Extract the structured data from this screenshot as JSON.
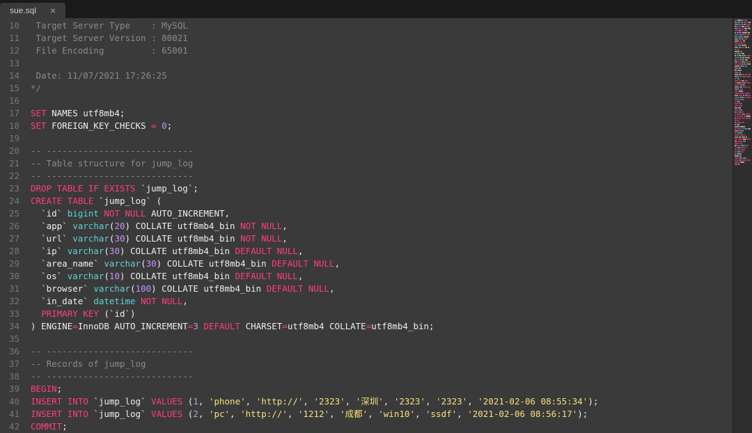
{
  "tab": {
    "label": "sue.sql",
    "close": "×"
  },
  "gutter": [
    "10",
    "11",
    "12",
    "13",
    "14",
    "15",
    "16",
    "17",
    "18",
    "19",
    "20",
    "21",
    "22",
    "23",
    "24",
    "25",
    "26",
    "27",
    "28",
    "29",
    "30",
    "31",
    "32",
    "33",
    "34",
    "35",
    "36",
    "37",
    "38",
    "39",
    "40",
    "41",
    "42"
  ],
  "lines": [
    [
      {
        "t": " Target Server Type    : MySQL",
        "c": "c-cmt"
      }
    ],
    [
      {
        "t": " Target Server Version : 80021",
        "c": "c-cmt"
      }
    ],
    [
      {
        "t": " File Encoding         : 65001",
        "c": "c-cmt"
      }
    ],
    [],
    [
      {
        "t": " Date: 11/07/2021 17:26:25",
        "c": "c-cmt"
      }
    ],
    [
      {
        "t": "*/",
        "c": "c-cmt"
      }
    ],
    [],
    [
      {
        "t": "SET",
        "c": "c-kw"
      },
      {
        "t": " NAMES utf8mb4;",
        "c": "c-txt"
      }
    ],
    [
      {
        "t": "SET",
        "c": "c-kw"
      },
      {
        "t": " FOREIGN_KEY_CHECKS ",
        "c": "c-txt"
      },
      {
        "t": "=",
        "c": "c-op"
      },
      {
        "t": " ",
        "c": "c-txt"
      },
      {
        "t": "0",
        "c": "c-num"
      },
      {
        "t": ";",
        "c": "c-txt"
      }
    ],
    [],
    [
      {
        "t": "-- ----------------------------",
        "c": "c-cmt"
      }
    ],
    [
      {
        "t": "-- Table structure for jump_log",
        "c": "c-cmt"
      }
    ],
    [
      {
        "t": "-- ----------------------------",
        "c": "c-cmt"
      }
    ],
    [
      {
        "t": "DROP",
        "c": "c-kw"
      },
      {
        "t": " ",
        "c": "c-txt"
      },
      {
        "t": "TABLE",
        "c": "c-kw"
      },
      {
        "t": " ",
        "c": "c-txt"
      },
      {
        "t": "IF",
        "c": "c-kw2"
      },
      {
        "t": " ",
        "c": "c-txt"
      },
      {
        "t": "EXISTS",
        "c": "c-kw2"
      },
      {
        "t": " ",
        "c": "c-txt"
      },
      {
        "t": "`jump_log`",
        "c": "c-id"
      },
      {
        "t": ";",
        "c": "c-txt"
      }
    ],
    [
      {
        "t": "CREATE",
        "c": "c-kw"
      },
      {
        "t": " ",
        "c": "c-txt"
      },
      {
        "t": "TABLE",
        "c": "c-kw"
      },
      {
        "t": " ",
        "c": "c-txt"
      },
      {
        "t": "`jump_log`",
        "c": "c-id"
      },
      {
        "t": " (",
        "c": "c-txt"
      }
    ],
    [
      {
        "t": "  ",
        "c": "c-txt"
      },
      {
        "t": "`id`",
        "c": "c-id"
      },
      {
        "t": " ",
        "c": "c-txt"
      },
      {
        "t": "bigint",
        "c": "c-fn"
      },
      {
        "t": " ",
        "c": "c-txt"
      },
      {
        "t": "NOT",
        "c": "c-kw"
      },
      {
        "t": " ",
        "c": "c-txt"
      },
      {
        "t": "NULL",
        "c": "c-kw"
      },
      {
        "t": " AUTO_INCREMENT,",
        "c": "c-txt"
      }
    ],
    [
      {
        "t": "  ",
        "c": "c-txt"
      },
      {
        "t": "`app`",
        "c": "c-id"
      },
      {
        "t": " ",
        "c": "c-txt"
      },
      {
        "t": "varchar",
        "c": "c-fn"
      },
      {
        "t": "(",
        "c": "c-txt"
      },
      {
        "t": "20",
        "c": "c-num"
      },
      {
        "t": ") COLLATE utf8mb4_bin ",
        "c": "c-txt"
      },
      {
        "t": "NOT",
        "c": "c-kw"
      },
      {
        "t": " ",
        "c": "c-txt"
      },
      {
        "t": "NULL",
        "c": "c-kw"
      },
      {
        "t": ",",
        "c": "c-txt"
      }
    ],
    [
      {
        "t": "  ",
        "c": "c-txt"
      },
      {
        "t": "`url`",
        "c": "c-id"
      },
      {
        "t": " ",
        "c": "c-txt"
      },
      {
        "t": "varchar",
        "c": "c-fn"
      },
      {
        "t": "(",
        "c": "c-txt"
      },
      {
        "t": "30",
        "c": "c-num"
      },
      {
        "t": ") COLLATE utf8mb4_bin ",
        "c": "c-txt"
      },
      {
        "t": "NOT",
        "c": "c-kw"
      },
      {
        "t": " ",
        "c": "c-txt"
      },
      {
        "t": "NULL",
        "c": "c-kw"
      },
      {
        "t": ",",
        "c": "c-txt"
      }
    ],
    [
      {
        "t": "  ",
        "c": "c-txt"
      },
      {
        "t": "`ip`",
        "c": "c-id"
      },
      {
        "t": " ",
        "c": "c-txt"
      },
      {
        "t": "varchar",
        "c": "c-fn"
      },
      {
        "t": "(",
        "c": "c-txt"
      },
      {
        "t": "30",
        "c": "c-num"
      },
      {
        "t": ") COLLATE utf8mb4_bin ",
        "c": "c-txt"
      },
      {
        "t": "DEFAULT",
        "c": "c-kw"
      },
      {
        "t": " ",
        "c": "c-txt"
      },
      {
        "t": "NULL",
        "c": "c-kw"
      },
      {
        "t": ",",
        "c": "c-txt"
      }
    ],
    [
      {
        "t": "  ",
        "c": "c-txt"
      },
      {
        "t": "`area_name`",
        "c": "c-id"
      },
      {
        "t": " ",
        "c": "c-txt"
      },
      {
        "t": "varchar",
        "c": "c-fn"
      },
      {
        "t": "(",
        "c": "c-txt"
      },
      {
        "t": "30",
        "c": "c-num"
      },
      {
        "t": ") COLLATE utf8mb4_bin ",
        "c": "c-txt"
      },
      {
        "t": "DEFAULT",
        "c": "c-kw"
      },
      {
        "t": " ",
        "c": "c-txt"
      },
      {
        "t": "NULL",
        "c": "c-kw"
      },
      {
        "t": ",",
        "c": "c-txt"
      }
    ],
    [
      {
        "t": "  ",
        "c": "c-txt"
      },
      {
        "t": "`os`",
        "c": "c-id"
      },
      {
        "t": " ",
        "c": "c-txt"
      },
      {
        "t": "varchar",
        "c": "c-fn"
      },
      {
        "t": "(",
        "c": "c-txt"
      },
      {
        "t": "10",
        "c": "c-num"
      },
      {
        "t": ") COLLATE utf8mb4_bin ",
        "c": "c-txt"
      },
      {
        "t": "DEFAULT",
        "c": "c-kw"
      },
      {
        "t": " ",
        "c": "c-txt"
      },
      {
        "t": "NULL",
        "c": "c-kw"
      },
      {
        "t": ",",
        "c": "c-txt"
      }
    ],
    [
      {
        "t": "  ",
        "c": "c-txt"
      },
      {
        "t": "`browser`",
        "c": "c-id"
      },
      {
        "t": " ",
        "c": "c-txt"
      },
      {
        "t": "varchar",
        "c": "c-fn"
      },
      {
        "t": "(",
        "c": "c-txt"
      },
      {
        "t": "100",
        "c": "c-num"
      },
      {
        "t": ") COLLATE utf8mb4_bin ",
        "c": "c-txt"
      },
      {
        "t": "DEFAULT",
        "c": "c-kw"
      },
      {
        "t": " ",
        "c": "c-txt"
      },
      {
        "t": "NULL",
        "c": "c-kw"
      },
      {
        "t": ",",
        "c": "c-txt"
      }
    ],
    [
      {
        "t": "  ",
        "c": "c-txt"
      },
      {
        "t": "`in_date`",
        "c": "c-id"
      },
      {
        "t": " ",
        "c": "c-txt"
      },
      {
        "t": "datetime",
        "c": "c-fn"
      },
      {
        "t": " ",
        "c": "c-txt"
      },
      {
        "t": "NOT",
        "c": "c-kw"
      },
      {
        "t": " ",
        "c": "c-txt"
      },
      {
        "t": "NULL",
        "c": "c-kw"
      },
      {
        "t": ",",
        "c": "c-txt"
      }
    ],
    [
      {
        "t": "  ",
        "c": "c-txt"
      },
      {
        "t": "PRIMARY",
        "c": "c-kw"
      },
      {
        "t": " ",
        "c": "c-txt"
      },
      {
        "t": "KEY",
        "c": "c-kw"
      },
      {
        "t": " (",
        "c": "c-txt"
      },
      {
        "t": "`id`",
        "c": "c-id"
      },
      {
        "t": ")",
        "c": "c-txt"
      }
    ],
    [
      {
        "t": ") ENGINE",
        "c": "c-txt"
      },
      {
        "t": "=",
        "c": "c-op"
      },
      {
        "t": "InnoDB AUTO_INCREMENT",
        "c": "c-txt"
      },
      {
        "t": "=",
        "c": "c-op"
      },
      {
        "t": "3",
        "c": "c-num"
      },
      {
        "t": " ",
        "c": "c-txt"
      },
      {
        "t": "DEFAULT",
        "c": "c-kw"
      },
      {
        "t": " CHARSET",
        "c": "c-txt"
      },
      {
        "t": "=",
        "c": "c-op"
      },
      {
        "t": "utf8mb4 COLLATE",
        "c": "c-txt"
      },
      {
        "t": "=",
        "c": "c-op"
      },
      {
        "t": "utf8mb4_bin;",
        "c": "c-txt"
      }
    ],
    [],
    [
      {
        "t": "-- ----------------------------",
        "c": "c-cmt"
      }
    ],
    [
      {
        "t": "-- Records of jump_log",
        "c": "c-cmt"
      }
    ],
    [
      {
        "t": "-- ----------------------------",
        "c": "c-cmt"
      }
    ],
    [
      {
        "t": "BEGIN",
        "c": "c-kw"
      },
      {
        "t": ";",
        "c": "c-txt"
      }
    ],
    [
      {
        "t": "INSERT",
        "c": "c-kw"
      },
      {
        "t": " ",
        "c": "c-txt"
      },
      {
        "t": "INTO",
        "c": "c-kw"
      },
      {
        "t": " ",
        "c": "c-txt"
      },
      {
        "t": "`jump_log`",
        "c": "c-id"
      },
      {
        "t": " ",
        "c": "c-txt"
      },
      {
        "t": "VALUES",
        "c": "c-kw"
      },
      {
        "t": " (",
        "c": "c-txt"
      },
      {
        "t": "1",
        "c": "c-num"
      },
      {
        "t": ", ",
        "c": "c-txt"
      },
      {
        "t": "'phone'",
        "c": "c-str"
      },
      {
        "t": ", ",
        "c": "c-txt"
      },
      {
        "t": "'http://'",
        "c": "c-str"
      },
      {
        "t": ", ",
        "c": "c-txt"
      },
      {
        "t": "'2323'",
        "c": "c-str"
      },
      {
        "t": ", ",
        "c": "c-txt"
      },
      {
        "t": "'深圳'",
        "c": "c-str"
      },
      {
        "t": ", ",
        "c": "c-txt"
      },
      {
        "t": "'2323'",
        "c": "c-str"
      },
      {
        "t": ", ",
        "c": "c-txt"
      },
      {
        "t": "'2323'",
        "c": "c-str"
      },
      {
        "t": ", ",
        "c": "c-txt"
      },
      {
        "t": "'2021-02-06 08:55:34'",
        "c": "c-str"
      },
      {
        "t": ");",
        "c": "c-txt"
      }
    ],
    [
      {
        "t": "INSERT",
        "c": "c-kw"
      },
      {
        "t": " ",
        "c": "c-txt"
      },
      {
        "t": "INTO",
        "c": "c-kw"
      },
      {
        "t": " ",
        "c": "c-txt"
      },
      {
        "t": "`jump_log`",
        "c": "c-id"
      },
      {
        "t": " ",
        "c": "c-txt"
      },
      {
        "t": "VALUES",
        "c": "c-kw"
      },
      {
        "t": " (",
        "c": "c-txt"
      },
      {
        "t": "2",
        "c": "c-num"
      },
      {
        "t": ", ",
        "c": "c-txt"
      },
      {
        "t": "'pc'",
        "c": "c-str"
      },
      {
        "t": ", ",
        "c": "c-txt"
      },
      {
        "t": "'http://'",
        "c": "c-str"
      },
      {
        "t": ", ",
        "c": "c-txt"
      },
      {
        "t": "'1212'",
        "c": "c-str"
      },
      {
        "t": ", ",
        "c": "c-txt"
      },
      {
        "t": "'成都'",
        "c": "c-str"
      },
      {
        "t": ", ",
        "c": "c-txt"
      },
      {
        "t": "'win10'",
        "c": "c-str"
      },
      {
        "t": ", ",
        "c": "c-txt"
      },
      {
        "t": "'ssdf'",
        "c": "c-str"
      },
      {
        "t": ", ",
        "c": "c-txt"
      },
      {
        "t": "'2021-02-06 08:56:17'",
        "c": "c-str"
      },
      {
        "t": ");",
        "c": "c-txt"
      }
    ],
    [
      {
        "t": "COMMIT",
        "c": "c-kw"
      },
      {
        "t": ";",
        "c": "c-txt"
      }
    ]
  ]
}
